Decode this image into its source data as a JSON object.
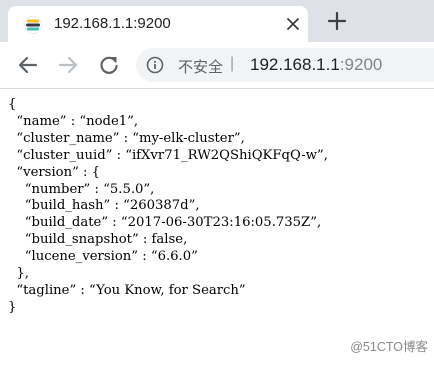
{
  "tab": {
    "title": "192.168.1.1:9200",
    "favicon": "elasticsearch-favicon"
  },
  "toolbar": {
    "security_label": "不安全",
    "separator": "|",
    "url_host": "192.168.1.1",
    "url_port": ":9200",
    "icons": [
      "back-arrow-icon",
      "forward-arrow-icon",
      "reload-icon",
      "info-icon"
    ]
  },
  "response": {
    "lines": [
      "{",
      "  “name” : “node1”,",
      "  “cluster_name” : “my-elk-cluster”,",
      "  “cluster_uuid” : “ifXvr71_RW2QShiQKFqQ-w”,",
      "  “version” : {",
      "    “number” : “5.5.0”,",
      "    “build_hash” : “260387d”,",
      "    “build_date” : “2017-06-30T23:16:05.735Z”,",
      "    “build_snapshot” : false,",
      "    “lucene_version” : “6.6.0”",
      "  },",
      "  “tagline” : “You Know, for Search”",
      "}"
    ]
  },
  "watermark": "@51CTO博客",
  "colors": {
    "tabstrip": "#dee1e6",
    "omnibox": "#f1f3f4",
    "text": "#202124",
    "muted": "#5f6368"
  }
}
